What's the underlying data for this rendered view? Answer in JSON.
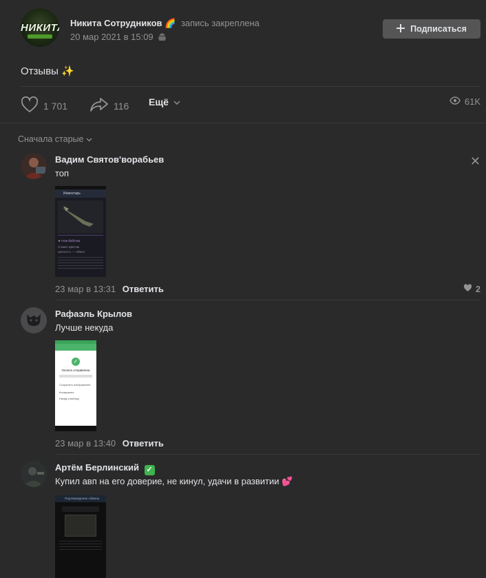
{
  "post": {
    "author_name": "Никита Сотрудников",
    "author_emoji": "🌈",
    "pinned_text": "запись закреплена",
    "date": "20 мар 2021 в 15:09",
    "avatar_text": "НИКИТА",
    "text": "Отзывы",
    "text_emoji": "✨",
    "subscribe_label": "Подписаться"
  },
  "actions": {
    "likes": "1 701",
    "shares": "116",
    "more_label": "Ещё",
    "views": "61K"
  },
  "comments_sort": "Сначала старые",
  "comments": [
    {
      "name": "Вадим Святов'ворабьев",
      "text": "топ",
      "date": "23 мар в 13:31",
      "reply_label": "Ответить",
      "likes": "2",
      "screenshot": {
        "title": "Инвентарь",
        "lines": [
          "★ Нож-бабочка",
          "Станет цветом",
          "ценность — обмен"
        ]
      }
    },
    {
      "name": "Рафаэль Крылов",
      "text": "Лучше некуда",
      "date": "23 мар в 13:40",
      "reply_label": "Ответить",
      "screenshot": {
        "title": "Оплата отправлена",
        "lines": [
          "Сохранить изображение",
          "Копировать",
          "Назад к выбору"
        ]
      }
    },
    {
      "name": "Артём Берлинский",
      "badge": "✓",
      "text": "Купил авп на его доверие, не кинул, удачи в развитии",
      "text_emoji": "💕",
      "screenshot": {
        "title": "Подтверждение обмена"
      }
    }
  ],
  "colors": {
    "background": "#2a2a2b",
    "text": "#e1e3e6",
    "secondary": "#939393",
    "button": "#555555"
  }
}
